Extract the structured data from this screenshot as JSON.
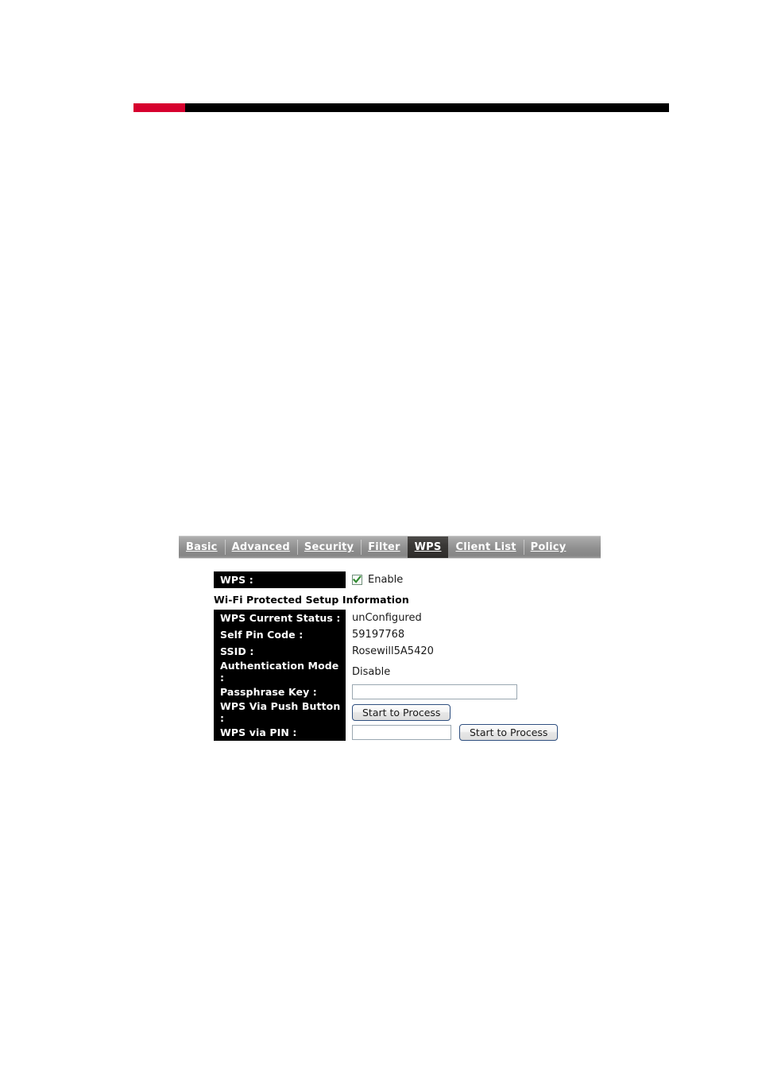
{
  "document": {
    "header_rule": {
      "accent_color": "#d6002e",
      "bar_color": "#000000"
    }
  },
  "router_ui": {
    "tabs": [
      {
        "label": "Basic",
        "active": false
      },
      {
        "label": "Advanced",
        "active": false
      },
      {
        "label": "Security",
        "active": false
      },
      {
        "label": "Filter",
        "active": false
      },
      {
        "label": "WPS",
        "active": true
      },
      {
        "label": "Client List",
        "active": false
      },
      {
        "label": "Policy",
        "active": false
      }
    ],
    "form": {
      "wps_label": "WPS :",
      "wps_enable_label": "Enable",
      "wps_enable_checked": true,
      "section_heading": "Wi-Fi Protected Setup Information",
      "rows": [
        {
          "label": "WPS Current Status :",
          "value": "unConfigured"
        },
        {
          "label": "Self Pin Code :",
          "value": "59197768"
        },
        {
          "label": "SSID :",
          "value": "Rosewill5A5420"
        },
        {
          "label": "Authentication Mode :",
          "value": "Disable"
        }
      ],
      "passphrase_label": "Passphrase Key :",
      "passphrase_value": "",
      "passphrase_placeholder": "",
      "push_button_label": "WPS Via Push Button :",
      "push_button_action": "Start to Process",
      "pin_label": "WPS via PIN :",
      "pin_value": "",
      "pin_placeholder": "",
      "pin_action": "Start to Process"
    }
  }
}
